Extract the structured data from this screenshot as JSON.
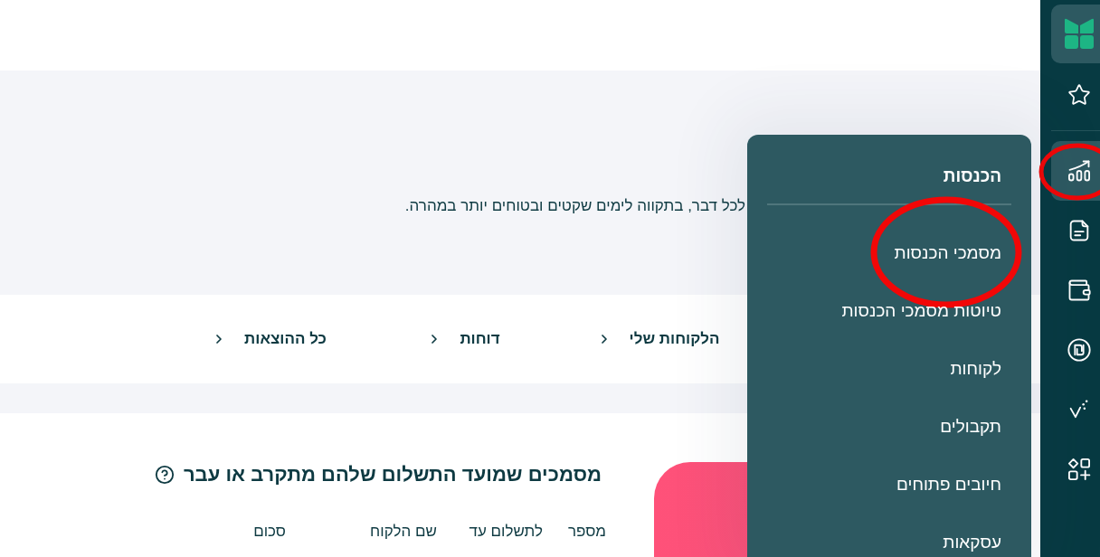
{
  "sidebar": {
    "pinned": [
      {
        "selected": false
      }
    ],
    "items": [
      {
        "selected": true,
        "circled": true
      },
      {
        "selected": false,
        "circled": false
      },
      {
        "selected": false,
        "circled": false
      },
      {
        "selected": false,
        "circled": false
      },
      {
        "selected": false,
        "circled": false
      },
      {
        "selected": false,
        "circled": false
      }
    ]
  },
  "notice": {
    "text": "לכל דבר, בתקווה לימים שקטים ובטוחים יותר במהרה."
  },
  "quick_links": [
    {
      "label": "הלקוחות שלי"
    },
    {
      "label": "דוחות"
    },
    {
      "label": "כל ההוצאות"
    }
  ],
  "due_documents": {
    "title": "מסמכים שמועד התשלום שלהם מתקרב או עבר",
    "columns": [
      "מספר",
      "לתשלום עד",
      "שם הלקוח",
      "סכום"
    ]
  },
  "menu": {
    "title": "הכנסות",
    "items": [
      {
        "label": "מסמכי הכנסות",
        "circled": true
      },
      {
        "label": "טיוטות מסמכי הכנסות",
        "circled": false
      },
      {
        "label": "לקוחות",
        "circled": false
      },
      {
        "label": "תקבולים",
        "circled": false
      },
      {
        "label": "חיובים פתוחים",
        "circled": false
      },
      {
        "label": "עסקאות",
        "circled": false
      }
    ]
  }
}
